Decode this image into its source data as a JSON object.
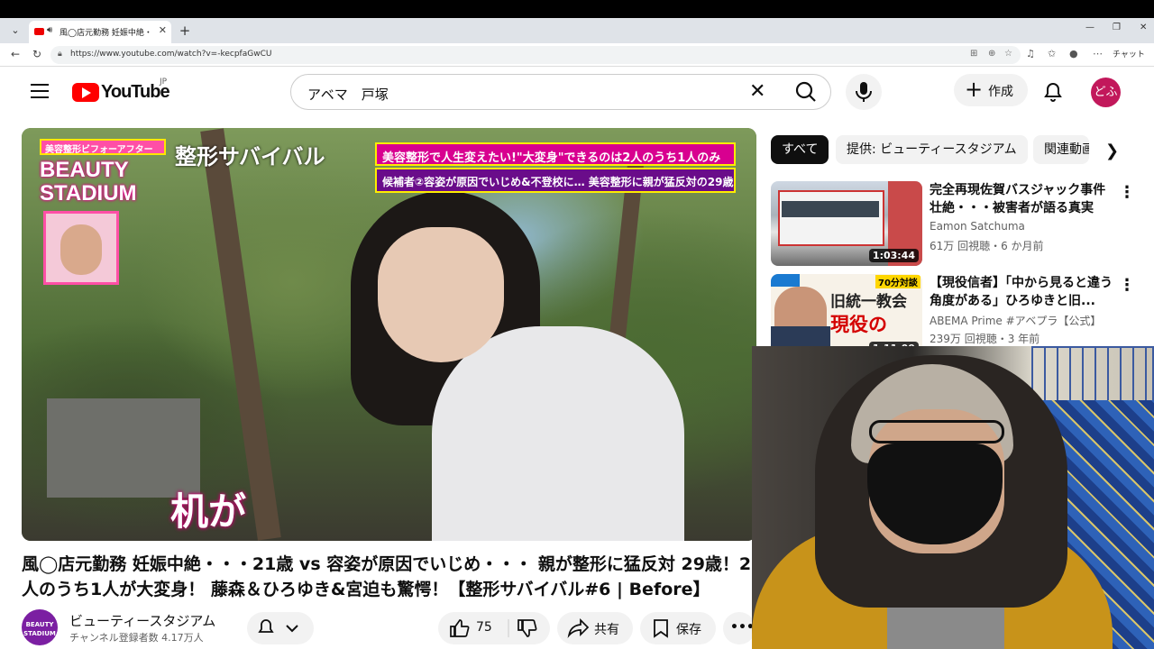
{
  "browser": {
    "tab_title": "風◯店元勤務 妊娠中絶・・・21歳",
    "url": "https://www.youtube.com/watch?v=-kecpfaGwCU",
    "chat_label": "チャット"
  },
  "masthead": {
    "logo_text": "YouTube",
    "region": "JP",
    "search_value": "アベマ　戸塚",
    "create_label": "作成",
    "avatar_text": "どふ"
  },
  "player": {
    "overlay_label": "美容整形ビフォーアフター",
    "beauty_line1": "BEAUTY",
    "beauty_line2": "STADIUM",
    "show_title": "整形サバイバル",
    "banner1": "美容整形で人生変えたい!\"大変身\"できるのは2人のうち1人のみ",
    "banner2": "候補者②容姿が原因でいじめ&不登校に… 美容整形に親が猛反対の29歳",
    "caption": "机が"
  },
  "video": {
    "title": "風◯店元勤務 妊娠中絶・・・21歳 vs 容姿が原因でいじめ・・・ 親が整形に猛反対 29歳！2人のうち1人が大変身！ 藤森＆ひろゆき&宮迫も驚愕！【整形サバイバル#6 | Before】",
    "channel_avatar_text": "BEAUTY STADIUM",
    "channel_name": "ビューティースタジアム",
    "subscribers": "チャンネル登録者数 4.17万人",
    "likes": "75",
    "share_label": "共有",
    "save_label": "保存"
  },
  "chips": [
    "すべて",
    "提供: ビューティースタジアム",
    "関連動画"
  ],
  "recommendations": [
    {
      "title": "完全再現佐賀バスジャック事件 壮絶・・・被害者が語る真実",
      "channel": "Eamon Satchuma",
      "meta": "61万 回視聴・6 か月前",
      "duration": "1:03:44"
    },
    {
      "title": "【現役信者】「中から見ると違う角度がある」ひろゆきと旧...",
      "channel": "ABEMA Prime #アベプラ【公式】",
      "meta": "239万 回視聴・3 年前",
      "duration": "1:11:09",
      "thumb_badge": "70分対談",
      "thumb_text1": "旧統一教会",
      "thumb_text2": "現役の"
    }
  ]
}
